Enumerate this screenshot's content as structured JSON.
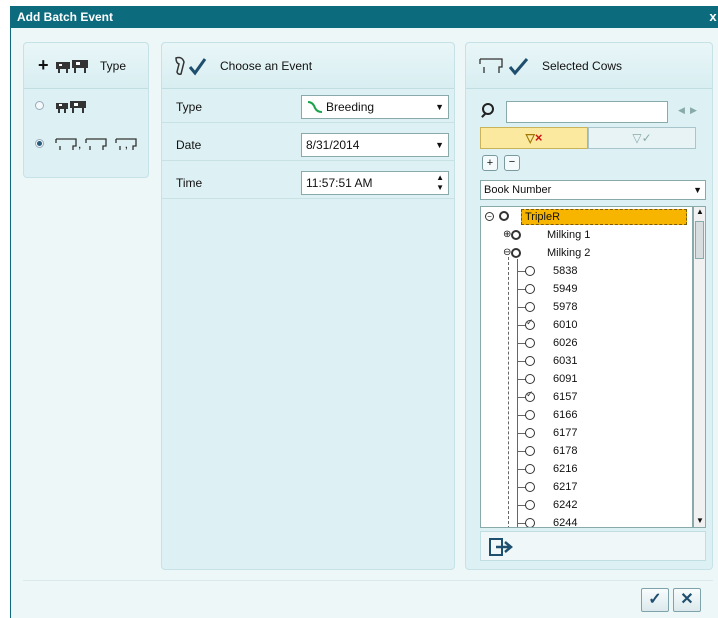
{
  "window": {
    "title": "Add Batch Event",
    "close_glyph": "x"
  },
  "type_panel": {
    "header": "Type",
    "options": [
      {
        "id": "single",
        "selected": false,
        "icon": "cow-herd-icon"
      },
      {
        "id": "multiple",
        "label": ",  ,",
        "selected": true,
        "icon": "cow-icon"
      }
    ]
  },
  "event_panel": {
    "header": "Choose an Event",
    "fields": {
      "type_label": "Type",
      "type_value": "Breeding",
      "date_label": "Date",
      "date_value": "8/31/2014",
      "time_label": "Time",
      "time_value": "11:57:51 AM"
    }
  },
  "cows_panel": {
    "header": "Selected Cows",
    "search": {
      "placeholder": ""
    },
    "sort_by": "Book Number",
    "tree": {
      "root": "TripleR",
      "groups": [
        "Milking 1",
        "Milking 2"
      ],
      "cows": [
        {
          "id": "5838",
          "checked": false
        },
        {
          "id": "5949",
          "checked": false
        },
        {
          "id": "5978",
          "checked": false
        },
        {
          "id": "6010",
          "checked": true
        },
        {
          "id": "6026",
          "checked": false
        },
        {
          "id": "6031",
          "checked": false
        },
        {
          "id": "6091",
          "checked": false
        },
        {
          "id": "6157",
          "checked": true
        },
        {
          "id": "6166",
          "checked": false
        },
        {
          "id": "6177",
          "checked": false
        },
        {
          "id": "6178",
          "checked": false
        },
        {
          "id": "6216",
          "checked": false
        },
        {
          "id": "6217",
          "checked": false
        },
        {
          "id": "6242",
          "checked": false
        },
        {
          "id": "6244",
          "checked": false
        }
      ]
    }
  },
  "footer": {
    "ok_glyph": "✓",
    "cancel_glyph": "✕"
  },
  "colors": {
    "titlebar": "#0d6b7e",
    "panel": "#ddf0f3",
    "root_highlight": "#f7b500",
    "filter_active": "#fbe9a0"
  }
}
